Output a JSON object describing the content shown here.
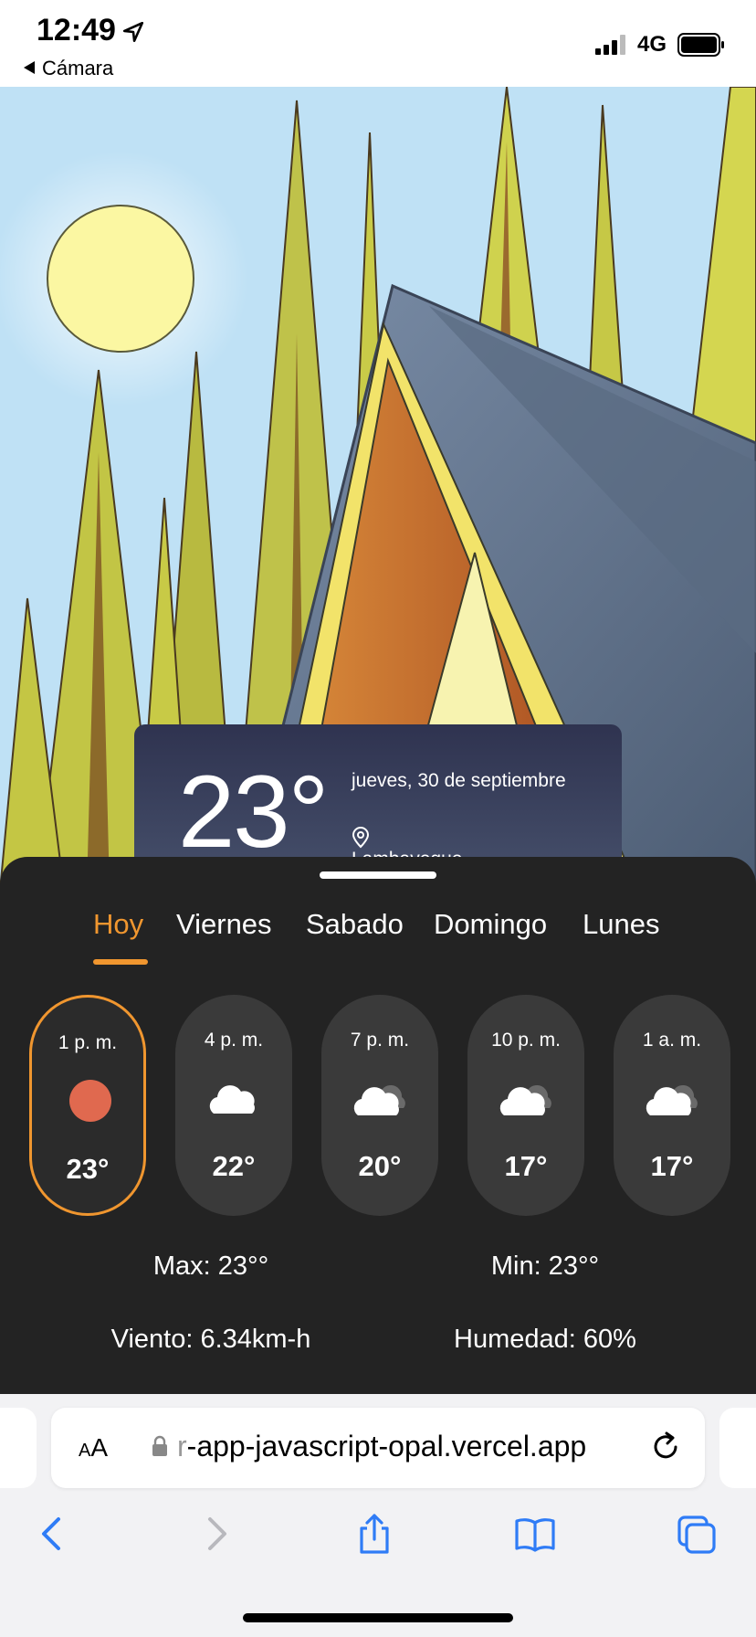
{
  "status_bar": {
    "time": "12:49",
    "back_label": "Cámara",
    "network": "4G"
  },
  "weather": {
    "current_temp": "23°",
    "date": "jueves, 30 de septiembre",
    "location": "Lambayeque"
  },
  "tabs": [
    "Hoy",
    "Viernes",
    "Sabado",
    "Domingo",
    "Lunes"
  ],
  "active_tab": "Hoy",
  "hourly": [
    {
      "time": "1 p. m.",
      "icon": "sun-icon",
      "temp": "23°",
      "selected": true
    },
    {
      "time": "4 p. m.",
      "icon": "cloud-icon",
      "temp": "22°",
      "selected": false
    },
    {
      "time": "7 p. m.",
      "icon": "partly-cloudy-icon",
      "temp": "20°",
      "selected": false
    },
    {
      "time": "10 p. m.",
      "icon": "partly-cloudy-icon",
      "temp": "17°",
      "selected": false
    },
    {
      "time": "1 a. m.",
      "icon": "partly-cloudy-icon",
      "temp": "17°",
      "selected": false
    }
  ],
  "stats": {
    "max": "Max: 23°°",
    "min": "Min: 23°°",
    "wind": "Viento: 6.34km-h",
    "humidity": "Humedad: 60%"
  },
  "browser": {
    "text_size": "AA",
    "url_faded": "r",
    "url": "-app-javascript-opal.vercel.app"
  },
  "colors": {
    "accent": "#f0962f",
    "sheet_bg": "#232323",
    "pill_bg": "#3a3a3a",
    "sun": "#e0694f"
  }
}
